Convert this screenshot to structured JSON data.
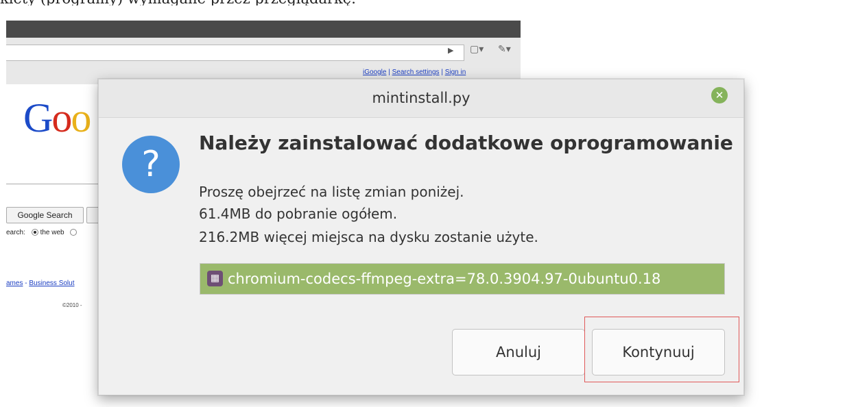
{
  "document": {
    "caption": "kiety (programy) wymagane przez przeglądarkę."
  },
  "browser": {
    "toplinks": [
      "iGoogle",
      "Search settings",
      "Sign in"
    ],
    "logo_text": "Goo",
    "search_button": "Google Search",
    "search_label": "earch:",
    "search_option": "the web",
    "biz_links": [
      "ames",
      "Business Solut"
    ],
    "copyright": "©2010 -"
  },
  "dialog": {
    "title": "mintinstall.py",
    "heading": "Należy zainstalować dodatkowe oprogramowanie",
    "info_lines": [
      "Proszę obejrzeć na listę zmian poniżej.",
      "61.4MB do pobranie ogółem.",
      "216.2MB więcej miejsca na dysku zostanie użyte."
    ],
    "packages": [
      "chromium-codecs-ffmpeg-extra=78.0.3904.97-0ubuntu0.18"
    ],
    "buttons": {
      "cancel": "Anuluj",
      "continue": "Kontynuuj"
    },
    "icon": "question-icon",
    "colors": {
      "question_icon": "#4a90d9",
      "close_button": "#85b35b",
      "selected_row": "#9ab96b",
      "highlight": "#e05858"
    }
  }
}
